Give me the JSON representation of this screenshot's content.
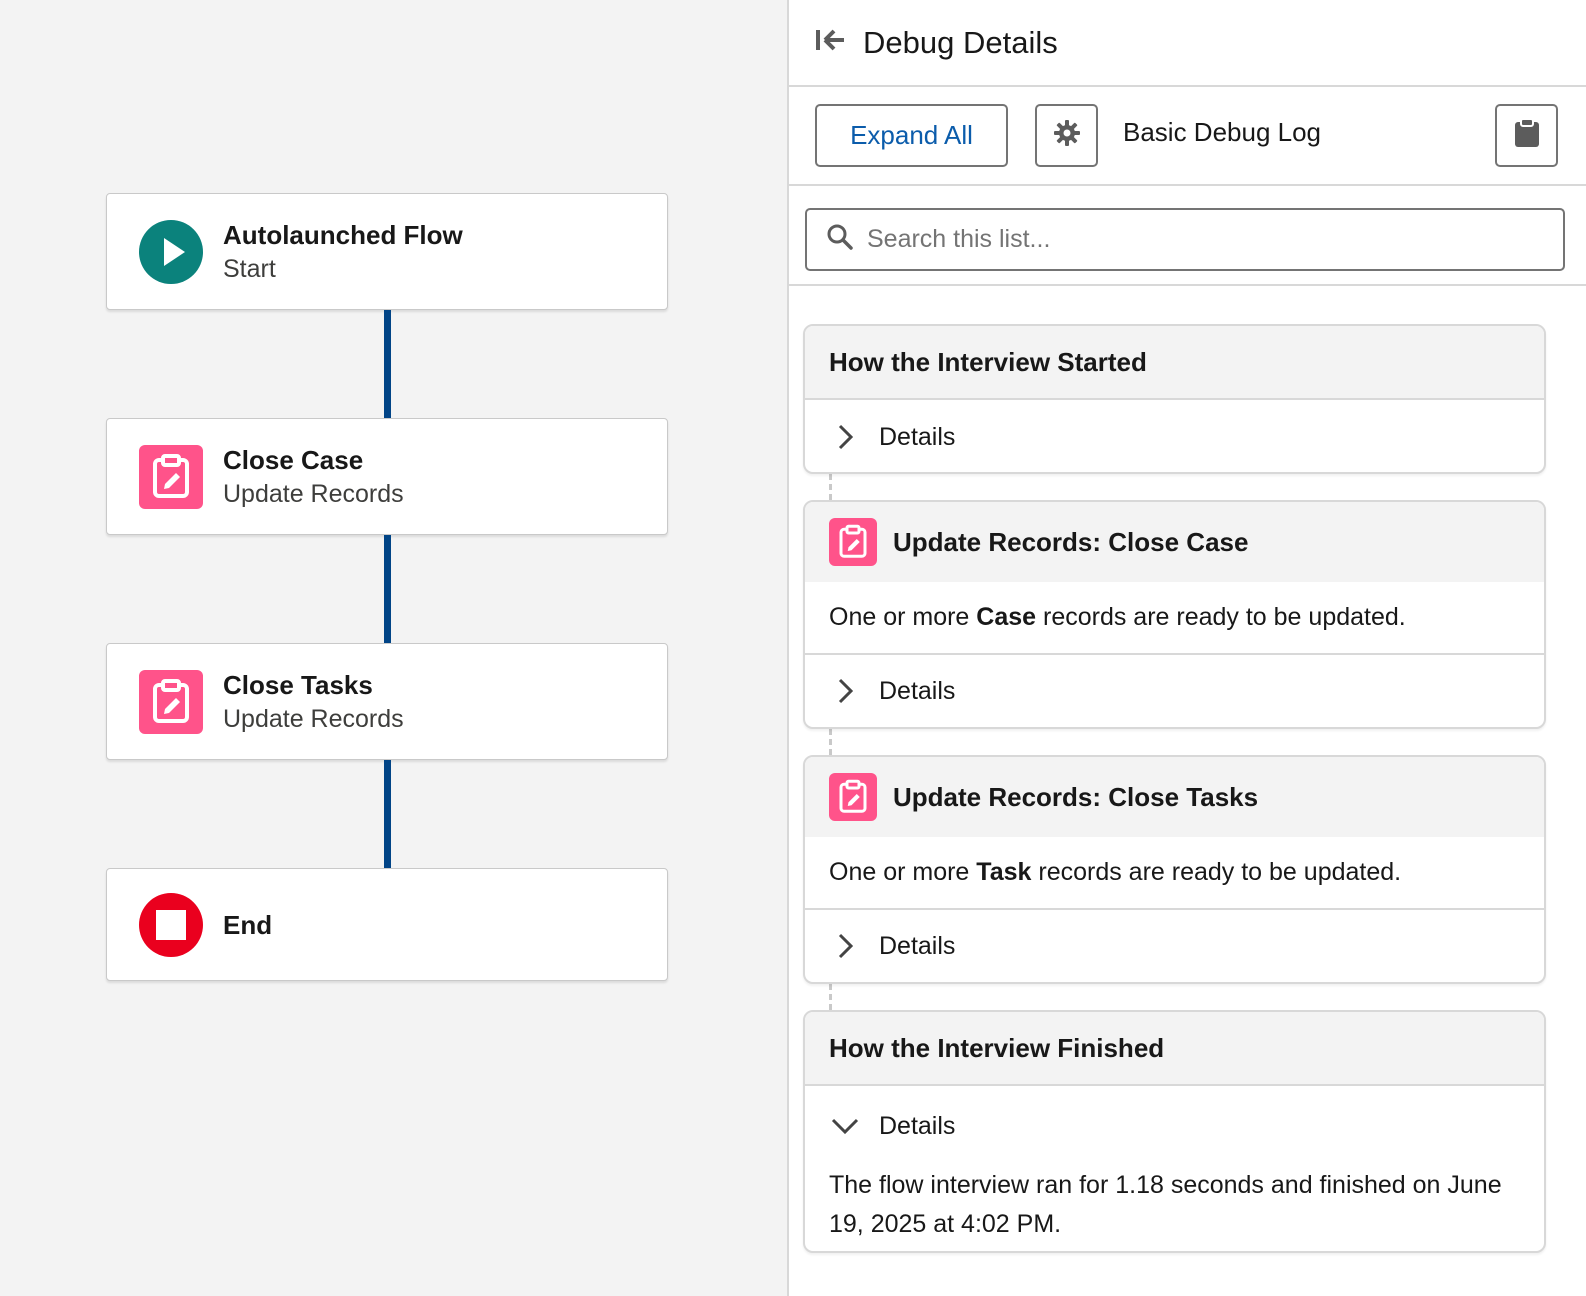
{
  "canvas": {
    "nodes": [
      {
        "title": "Autolaunched Flow",
        "subtitle": "Start",
        "icon": "play-icon",
        "color": "#0b827c"
      },
      {
        "title": "Close Case",
        "subtitle": "Update Records",
        "icon": "update-records-icon",
        "color": "#ff538a"
      },
      {
        "title": "Close Tasks",
        "subtitle": "Update Records",
        "icon": "update-records-icon",
        "color": "#ff538a"
      },
      {
        "title": "End",
        "subtitle": "",
        "icon": "stop-icon",
        "color": "#ea001e"
      }
    ],
    "connector_color": "#014486"
  },
  "panel": {
    "title": "Debug Details",
    "collapse_icon": "collapse-panel-icon",
    "toolbar": {
      "expand_all": "Expand All",
      "settings_icon": "gear-icon",
      "log_level": "Basic Debug Log",
      "copy_icon": "clipboard-icon"
    },
    "search": {
      "placeholder": "Search this list..."
    },
    "cards": {
      "started": {
        "title": "How the Interview Started",
        "details": "Details"
      },
      "close_case": {
        "title": "Update Records: Close Case",
        "text_before": "One or more ",
        "text_bold": "Case",
        "text_after": " records are ready to be updated.",
        "details": "Details"
      },
      "close_tasks": {
        "title": "Update Records: Close Tasks",
        "text_before": "One or more ",
        "text_bold": "Task",
        "text_after": " records are ready to be updated.",
        "details": "Details"
      },
      "finished": {
        "title": "How the Interview Finished",
        "details": "Details",
        "text": "The flow interview ran for 1.18 seconds and finished on June 19, 2025 at 4:02 PM."
      }
    },
    "accent_color": "#0b5cab"
  }
}
